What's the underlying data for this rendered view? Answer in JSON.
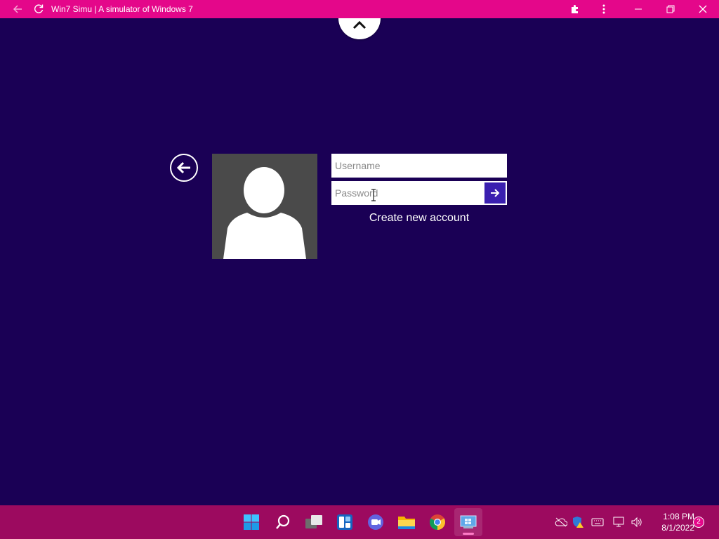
{
  "browser": {
    "title": "Win7 Simu | A simulator of Windows 7",
    "icons": [
      "back-arrow-icon",
      "refresh-icon",
      "extensions-icon",
      "more-icon",
      "minimize-icon",
      "restore-icon",
      "close-icon"
    ]
  },
  "logon": {
    "username_placeholder": "Username",
    "password_placeholder": "Password",
    "create_account": "Create new account",
    "colors": {
      "background": "#1a0055",
      "submit_button": "#3a1fb0",
      "user_tile": "#4a4a4a"
    }
  },
  "taskbar": {
    "apps": [
      "windows-start-icon",
      "search-icon",
      "task-view-icon",
      "widgets-icon",
      "teams-chat-icon",
      "file-explorer-icon",
      "chrome-icon",
      "win7-simu-app-icon"
    ],
    "tray": [
      "onedrive-offline-icon",
      "security-warning-icon",
      "keyboard-icon",
      "network-icon",
      "volume-icon"
    ],
    "time": "1:08 PM",
    "date": "8/1/2022",
    "notification_count": "2",
    "colors": {
      "taskbar": "#9c0a5f",
      "titlebar": "#e4078a"
    }
  }
}
